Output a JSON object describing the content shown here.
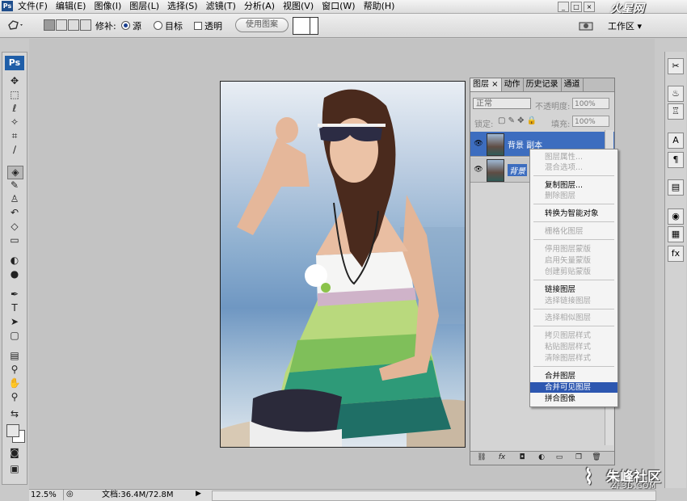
{
  "app": {
    "icon_text": "Ps"
  },
  "menu": [
    "文件(F)",
    "编辑(E)",
    "图像(I)",
    "图层(L)",
    "选择(S)",
    "滤镜(T)",
    "分析(A)",
    "视图(V)",
    "窗口(W)",
    "帮助(H)"
  ],
  "window_controls": [
    "_",
    "□",
    "×"
  ],
  "logo_text": "火星网",
  "options": {
    "repair_label": "修补:",
    "source_label": "源",
    "target_label": "目标",
    "transparent_label": "透明",
    "use_pattern_label": "使用图案",
    "workspace_label": "工作区 ▾"
  },
  "toolbox": {
    "badge": "Ps"
  },
  "layers_panel": {
    "tabs": [
      "图层 ×",
      "动作",
      "历史记录",
      "通道"
    ],
    "blend_mode": "正常",
    "opacity_label": "不透明度:",
    "opacity_value": "100%",
    "lock_label": "锁定:",
    "fill_label": "填充:",
    "fill_value": "100%",
    "layers": [
      {
        "name": "背景 副本",
        "selected": true
      },
      {
        "name": "背景",
        "selected": false
      }
    ],
    "footer_icons": [
      "link-icon",
      "fx-icon",
      "mask-icon",
      "adjustment-icon",
      "folder-icon",
      "new-layer-icon",
      "trash-icon"
    ]
  },
  "context_menu": {
    "items": [
      {
        "label": "图层属性...",
        "disabled": true
      },
      {
        "label": "混合选项...",
        "disabled": true
      },
      {
        "label": "复制图层...",
        "disabled": false
      },
      {
        "label": "删除图层",
        "disabled": true
      },
      {
        "label": "转换为智能对象",
        "disabled": false
      },
      {
        "label": "栅格化图层",
        "disabled": true
      },
      {
        "label": "停用图层蒙版",
        "disabled": true
      },
      {
        "label": "启用矢量蒙版",
        "disabled": true
      },
      {
        "label": "创建剪贴蒙版",
        "disabled": true
      },
      {
        "label": "链接图层",
        "disabled": false
      },
      {
        "label": "选择链接图层",
        "disabled": true
      },
      {
        "label": "选择相似图层",
        "disabled": true
      },
      {
        "label": "拷贝图层样式",
        "disabled": true
      },
      {
        "label": "粘贴图层样式",
        "disabled": true
      },
      {
        "label": "清除图层样式",
        "disabled": true
      },
      {
        "label": "合并图层",
        "disabled": false
      },
      {
        "label": "合并可见图层",
        "disabled": false,
        "highlighted": true
      },
      {
        "label": "拼合图像",
        "disabled": false
      }
    ]
  },
  "statusbar": {
    "zoom": "12.5%",
    "doc_info": "文档:36.4M/72.8M"
  },
  "watermark": {
    "main": "朱峰社区",
    "sub": "ZF3D.COM"
  }
}
